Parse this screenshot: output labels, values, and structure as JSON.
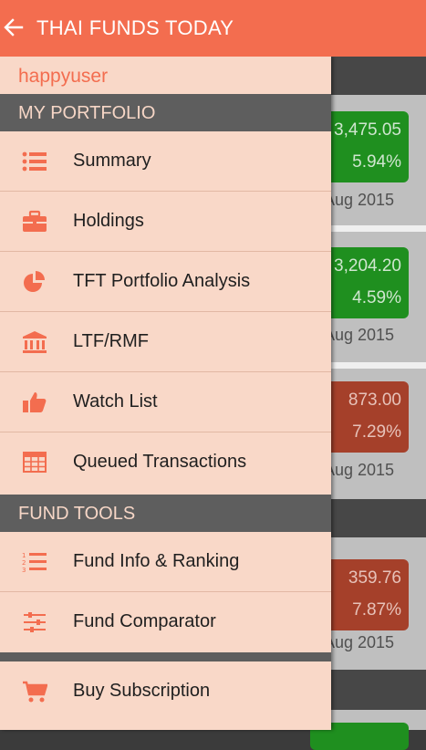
{
  "app_bar": {
    "title": "THAI FUNDS TODAY",
    "back_icon": "arrow-left-icon",
    "color": "#f36d4f"
  },
  "drawer": {
    "username": "happyuser",
    "sections": [
      {
        "title": "MY PORTFOLIO",
        "items": [
          {
            "label": "Summary",
            "icon": "list-icon"
          },
          {
            "label": "Holdings",
            "icon": "briefcase-icon"
          },
          {
            "label": "TFT Portfolio Analysis",
            "icon": "pie-chart-icon"
          },
          {
            "label": "LTF/RMF",
            "icon": "bank-icon"
          },
          {
            "label": "Watch List",
            "icon": "thumbs-up-icon"
          },
          {
            "label": "Queued Transactions",
            "icon": "table-icon"
          }
        ]
      },
      {
        "title": "FUND TOOLS",
        "items": [
          {
            "label": "Fund Info & Ranking",
            "icon": "numbered-list-icon"
          },
          {
            "label": "Fund Comparator",
            "icon": "sliders-icon"
          }
        ]
      }
    ],
    "extra_items": [
      {
        "label": "Buy Subscription",
        "icon": "cart-icon"
      }
    ]
  },
  "background_cards": [
    {
      "value": "3,475.05",
      "change": "5.94%",
      "date": "Aug 2015",
      "status": "up"
    },
    {
      "value": "3,204.20",
      "change": "4.59%",
      "date": "Aug 2015",
      "status": "up"
    },
    {
      "value": "873.00",
      "change": "7.29%",
      "date": "Aug 2015",
      "status": "down"
    },
    {
      "value": "359.76",
      "change": "7.87%",
      "date": "Aug 2015",
      "status": "down"
    }
  ]
}
